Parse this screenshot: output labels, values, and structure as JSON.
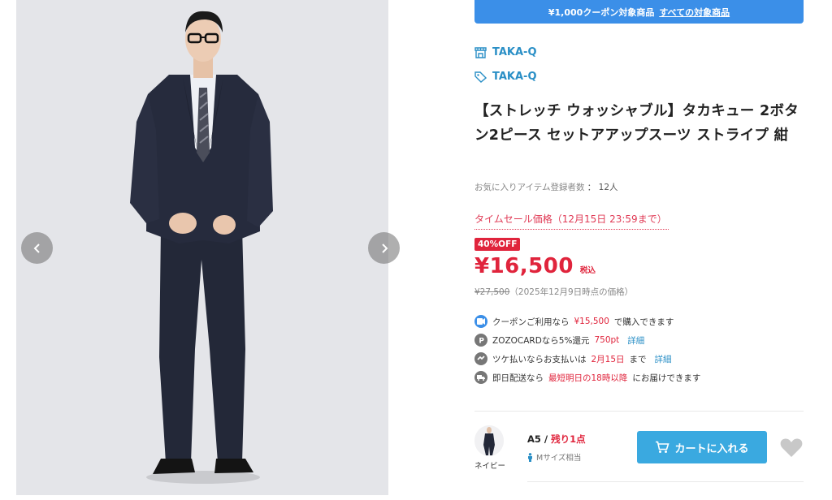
{
  "colors": {
    "accent_blue": "#3b8fe8",
    "link_blue": "#2a8fc6",
    "sale_red": "#e0243c",
    "cart_button": "#3aa9e0",
    "image_bg": "#e4e5e9"
  },
  "gallery": {
    "prev_icon": "chevron-left-icon",
    "next_icon": "chevron-right-icon"
  },
  "coupon": {
    "text": "¥1,000クーポン対象商品",
    "link": "すべての対象商品"
  },
  "brand": {
    "shop": "TAKA-Q",
    "shop_icon": "store-icon",
    "tag": "TAKA-Q",
    "tag_icon": "tag-icon"
  },
  "product": {
    "title": "【ストレッチ ウォッシャブル】タカキュー 2ボタン2ピース セットアアップスーツ ストライプ 紺",
    "favorites_label": "お気に入りアイテム登録者数",
    "favorites_sep": "：",
    "favorites_count": "12人",
    "sale_label": "タイムセール価格（12月15日 23:59まで）",
    "off_badge": "40%OFF",
    "price": "¥16,500",
    "tax_label": "税込",
    "original_price": "¥27,500",
    "original_note": "（2025年12月9日時点の価格）"
  },
  "benefits": [
    {
      "icon": "coupon-icon",
      "pre": "クーポンご利用なら",
      "highlight": "¥15,500",
      "post": "で購入できます",
      "link": ""
    },
    {
      "icon": "points-icon",
      "pre": "ZOZOCARDなら5%還元",
      "highlight": "750pt",
      "post": "",
      "link": "詳細"
    },
    {
      "icon": "deferred-payment-icon",
      "pre": "ツケ払いならお支払いは",
      "highlight": "2月15日",
      "post": "まで",
      "link": "詳細"
    },
    {
      "icon": "delivery-truck-icon",
      "pre": "即日配送なら",
      "highlight": "最短明日の18時以降",
      "post": "にお届けできます",
      "link": ""
    }
  ],
  "variant": {
    "color_label": "ネイビー",
    "size": "A5",
    "separator": "/",
    "stock": "残り1点",
    "fit_icon": "person-icon",
    "fit": "Mサイズ相当",
    "cart_button": "カートに入れる",
    "cart_icon": "cart-icon",
    "favorite_icon": "heart-icon"
  }
}
